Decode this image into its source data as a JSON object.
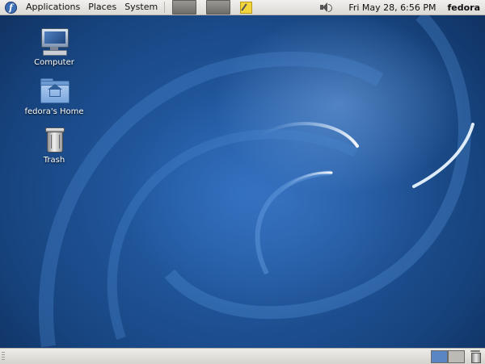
{
  "top_panel": {
    "logo_letter": "f",
    "menus": [
      "Applications",
      "Places",
      "System"
    ],
    "clock": "Fri May 28,  6:56 PM",
    "user": "fedora"
  },
  "desktop": {
    "icons": [
      {
        "label": "Computer",
        "icon": "computer-icon"
      },
      {
        "label": "fedora's Home",
        "icon": "home-folder-icon"
      },
      {
        "label": "Trash",
        "icon": "trash-icon"
      }
    ]
  },
  "bottom_panel": {
    "workspaces": 2,
    "active_workspace": 1
  },
  "colors": {
    "wallpaper": "#1c4f93",
    "panel": "#e4e2de",
    "active_workspace": "#5b86c4"
  }
}
